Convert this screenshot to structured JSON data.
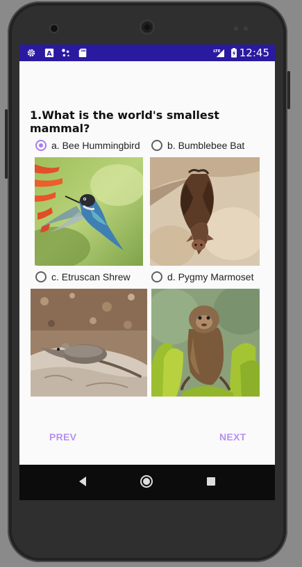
{
  "status_bar": {
    "time": "12:45",
    "left_icons": [
      "gear-icon",
      "font-a-icon",
      "dots-icon",
      "sd-card-icon"
    ],
    "right_icons": [
      "lte-signal-icon",
      "battery-charging-icon"
    ],
    "lte_label": "LTE",
    "font_icon_glyph": "A",
    "background_color": "#2a1aa0"
  },
  "quiz": {
    "question": "1.What is the world's smallest mammal?",
    "options": [
      {
        "label": "a. Bee Hummingbird",
        "selected": true,
        "image": "hummingbird"
      },
      {
        "label": "b. Bumblebee Bat",
        "selected": false,
        "image": "bat"
      },
      {
        "label": "c. Etruscan Shrew",
        "selected": false,
        "image": "shrew"
      },
      {
        "label": "d. Pygmy Marmoset",
        "selected": false,
        "image": "marmoset"
      }
    ],
    "accent_color": "#a87cf0"
  },
  "navigation": {
    "prev_label": "PREV",
    "next_label": "NEXT"
  },
  "system_nav": {
    "icons": [
      "back-icon",
      "home-icon",
      "recents-icon"
    ]
  }
}
